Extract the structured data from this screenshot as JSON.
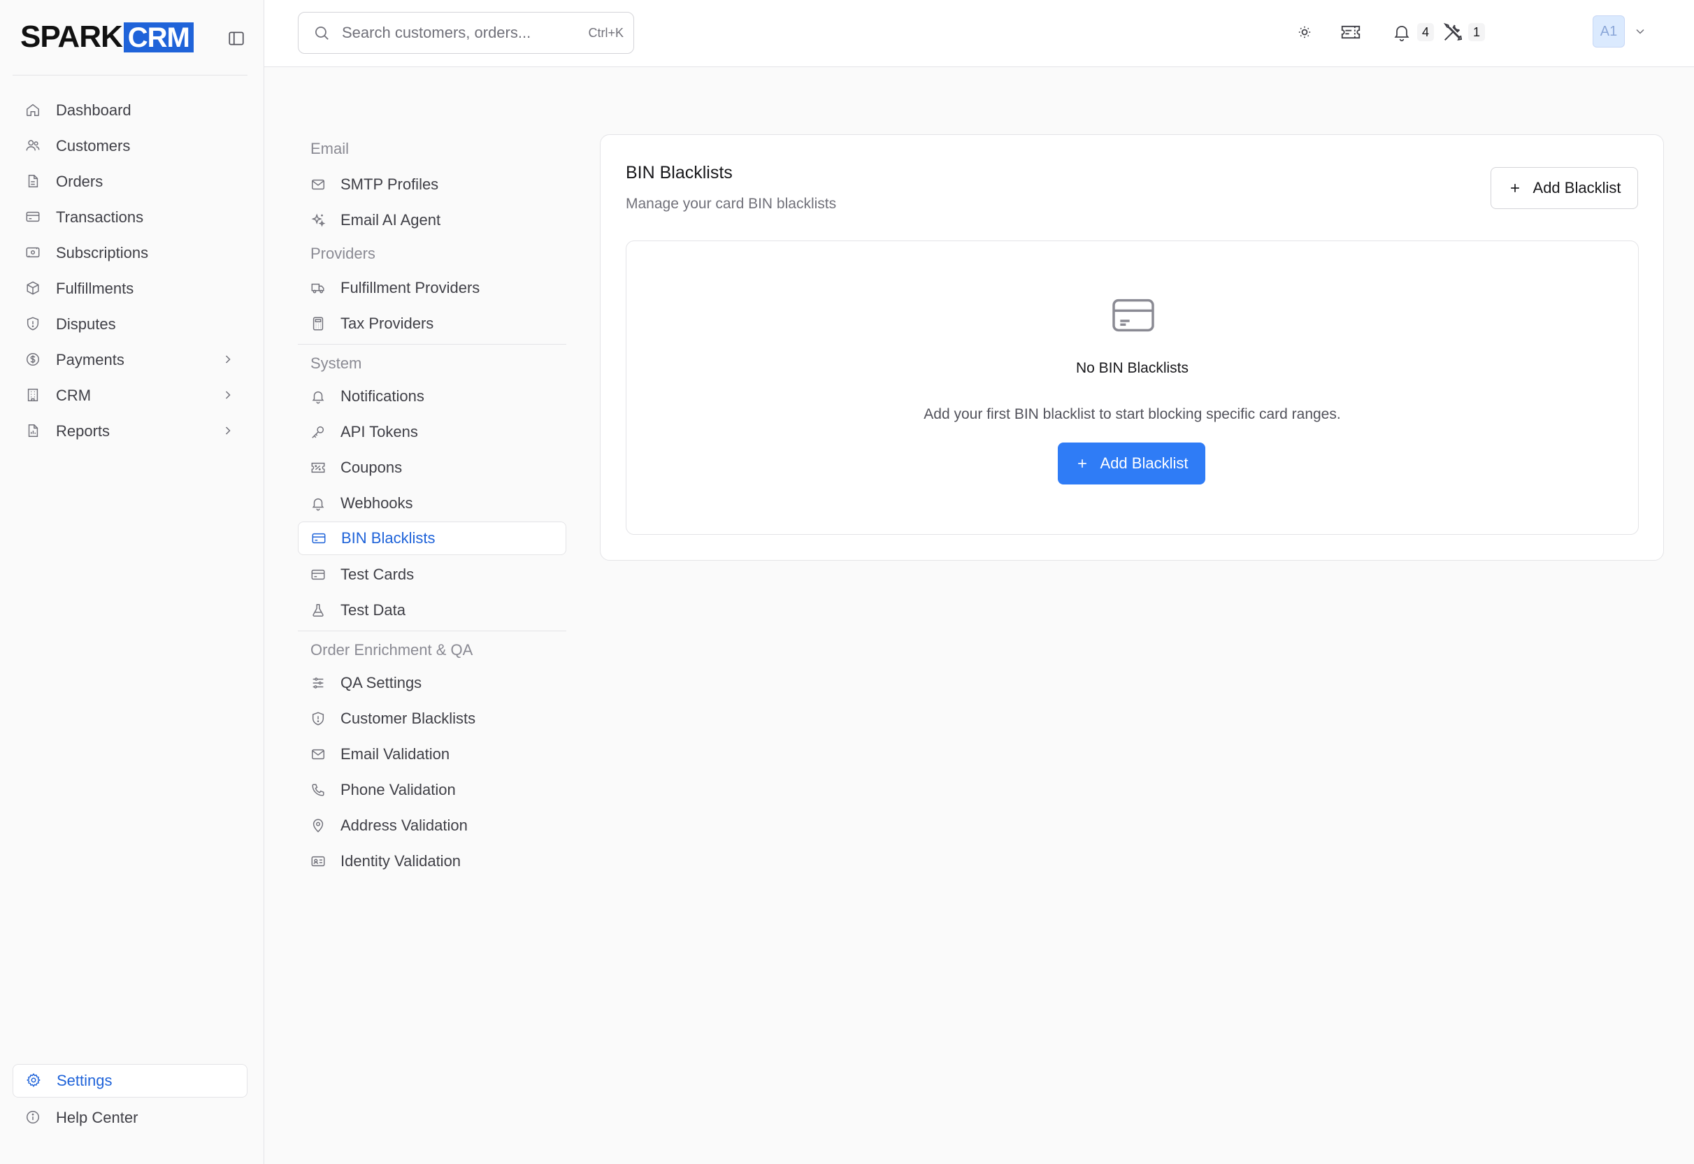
{
  "brand": {
    "name_primary": "SPARK",
    "name_accent": "CRM",
    "accent_color": "#1f63d9"
  },
  "sidebar": {
    "items": [
      {
        "label": "Dashboard",
        "icon": "home-icon"
      },
      {
        "label": "Customers",
        "icon": "users-icon"
      },
      {
        "label": "Orders",
        "icon": "document-icon"
      },
      {
        "label": "Transactions",
        "icon": "credit-card-icon"
      },
      {
        "label": "Subscriptions",
        "icon": "banknote-icon"
      },
      {
        "label": "Fulfillments",
        "icon": "package-icon"
      },
      {
        "label": "Disputes",
        "icon": "shield-icon"
      },
      {
        "label": "Payments",
        "icon": "dollar-circle-icon",
        "expandable": true
      },
      {
        "label": "CRM",
        "icon": "building-icon",
        "expandable": true
      },
      {
        "label": "Reports",
        "icon": "report-icon",
        "expandable": true
      }
    ],
    "bottom": [
      {
        "label": "Settings",
        "icon": "gear-icon",
        "active": true
      },
      {
        "label": "Help Center",
        "icon": "info-icon"
      }
    ]
  },
  "topbar": {
    "search": {
      "placeholder": "Search customers, orders...",
      "shortcut": "Ctrl+K",
      "value": ""
    },
    "notifications_count": "4",
    "tools_count": "1",
    "avatar_initials": "A1"
  },
  "settings_nav": {
    "groups": [
      {
        "heading": "Email",
        "items": [
          {
            "label": "SMTP Profiles",
            "icon": "mail-icon"
          },
          {
            "label": "Email AI Agent",
            "icon": "sparkles-icon"
          }
        ]
      },
      {
        "heading": "Providers",
        "items": [
          {
            "label": "Fulfillment Providers",
            "icon": "truck-icon"
          },
          {
            "label": "Tax Providers",
            "icon": "calculator-icon"
          }
        ]
      },
      {
        "heading": "System",
        "items": [
          {
            "label": "Notifications",
            "icon": "bell-icon"
          },
          {
            "label": "API Tokens",
            "icon": "key-icon"
          },
          {
            "label": "Coupons",
            "icon": "ticket-icon"
          },
          {
            "label": "Webhooks",
            "icon": "bell-icon"
          },
          {
            "label": "BIN Blacklists",
            "icon": "credit-card-icon",
            "active": true
          },
          {
            "label": "Test Cards",
            "icon": "credit-card-icon"
          },
          {
            "label": "Test Data",
            "icon": "flask-icon"
          }
        ]
      },
      {
        "heading": "Order Enrichment & QA",
        "items": [
          {
            "label": "QA Settings",
            "icon": "sliders-icon"
          },
          {
            "label": "Customer Blacklists",
            "icon": "shield-icon"
          },
          {
            "label": "Email Validation",
            "icon": "mail-icon"
          },
          {
            "label": "Phone Validation",
            "icon": "phone-icon"
          },
          {
            "label": "Address Validation",
            "icon": "map-pin-icon"
          },
          {
            "label": "Identity Validation",
            "icon": "id-card-icon"
          }
        ]
      }
    ]
  },
  "main": {
    "title": "BIN Blacklists",
    "subtitle": "Manage your card BIN blacklists",
    "add_button_label": "Add Blacklist",
    "empty_state": {
      "icon": "credit-card-icon",
      "title": "No BIN Blacklists",
      "description": "Add your first BIN blacklist to start blocking specific card ranges.",
      "button_label": "Add Blacklist"
    }
  }
}
